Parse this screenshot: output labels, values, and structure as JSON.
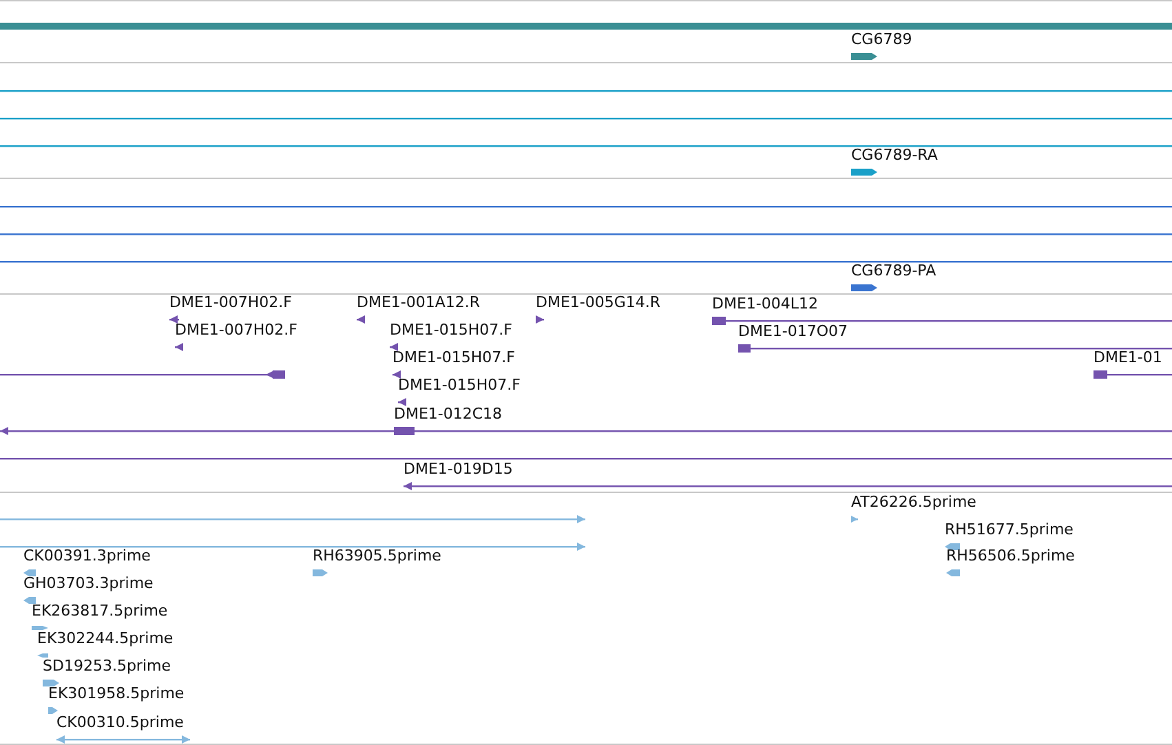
{
  "tracks": [
    {
      "color": "#3a8f94",
      "features": [
        {
          "kind": "line"
        },
        {
          "kind": "feature",
          "label": "CG6789"
        }
      ]
    },
    {
      "color": "#1aa0c8",
      "features": [
        {
          "kind": "line"
        },
        {
          "kind": "line"
        },
        {
          "kind": "line"
        },
        {
          "kind": "feature",
          "label": "CG6789-RA"
        }
      ]
    },
    {
      "color": "#3a74d0",
      "features": [
        {
          "kind": "line"
        },
        {
          "kind": "line"
        },
        {
          "kind": "line"
        },
        {
          "kind": "feature",
          "label": "CG6789-PA"
        }
      ]
    },
    {
      "color": "#7453ae",
      "features": [
        {
          "kind": "feature",
          "label": "DME1-007H02.F"
        },
        {
          "kind": "feature",
          "label": "DME1-001A12.R"
        },
        {
          "kind": "feature",
          "label": "DME1-005G14.R"
        },
        {
          "kind": "feature",
          "label": "DME1-004L12"
        },
        {
          "kind": "feature",
          "label": "DME1-007H02.F"
        },
        {
          "kind": "feature",
          "label": "DME1-015H07.F"
        },
        {
          "kind": "feature",
          "label": "DME1-017O07"
        },
        {
          "kind": "line"
        },
        {
          "kind": "feature",
          "label": "DME1-015H07.F"
        },
        {
          "kind": "feature",
          "label": "DME1-01"
        },
        {
          "kind": "feature",
          "label": "DME1-015H07.F"
        },
        {
          "kind": "feature",
          "label": "DME1-012C18"
        },
        {
          "kind": "line"
        },
        {
          "kind": "feature",
          "label": "DME1-019D15"
        }
      ]
    },
    {
      "color": "#84b8de",
      "features": [
        {
          "kind": "line"
        },
        {
          "kind": "feature",
          "label": "AT26226.5prime"
        },
        {
          "kind": "line"
        },
        {
          "kind": "feature",
          "label": "RH51677.5prime"
        },
        {
          "kind": "feature",
          "label": "CK00391.3prime"
        },
        {
          "kind": "feature",
          "label": "RH63905.5prime"
        },
        {
          "kind": "feature",
          "label": "RH56506.5prime"
        },
        {
          "kind": "feature",
          "label": "GH03703.3prime"
        },
        {
          "kind": "feature",
          "label": "EK263817.5prime"
        },
        {
          "kind": "feature",
          "label": "EK302244.5prime"
        },
        {
          "kind": "feature",
          "label": "SD19253.5prime"
        },
        {
          "kind": "feature",
          "label": "EK301958.5prime"
        },
        {
          "kind": "feature",
          "label": "CK00310.5prime"
        }
      ]
    }
  ]
}
